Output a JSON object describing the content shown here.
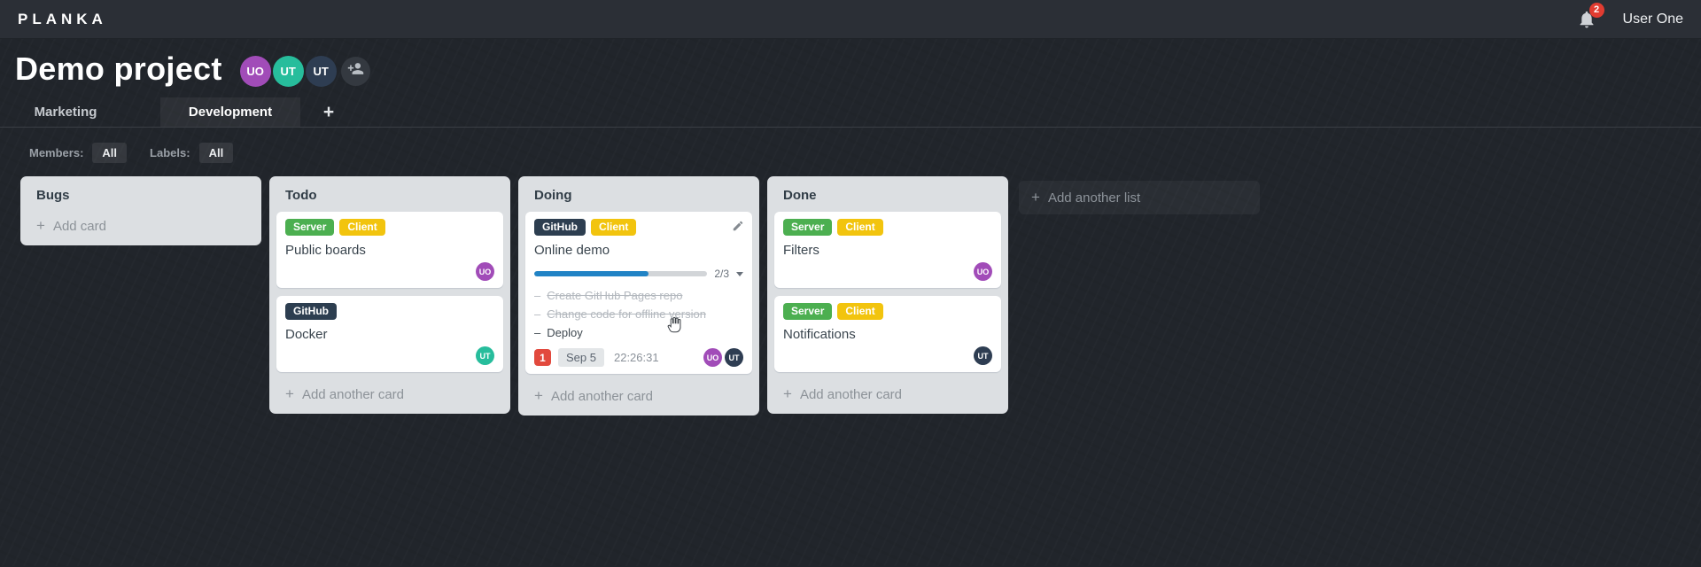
{
  "ui": {
    "plus": "+",
    "task_marker": "–"
  },
  "topbar": {
    "logo": "PLANKA",
    "notifications": {
      "count": "2"
    },
    "user_name": "User One"
  },
  "project": {
    "title": "Demo project",
    "members": [
      {
        "initials": "UO",
        "color": "#a14cb8"
      },
      {
        "initials": "UT",
        "color": "#27bd9c"
      },
      {
        "initials": "UT",
        "color": "#2e3d52"
      }
    ]
  },
  "tabs": {
    "items": [
      {
        "label": "Marketing",
        "active": false
      },
      {
        "label": "Development",
        "active": true
      }
    ]
  },
  "filters": {
    "members_label": "Members:",
    "members_value": "All",
    "labels_label": "Labels:",
    "labels_value": "All"
  },
  "board": {
    "add_list_label": "Add another list",
    "lists": [
      {
        "title": "Bugs",
        "add_card_label": "Add card",
        "cards": []
      },
      {
        "title": "Todo",
        "add_card_label": "Add another card",
        "cards": [
          {
            "title": "Public boards",
            "labels": [
              {
                "text": "Server",
                "color": "#4caf50"
              },
              {
                "text": "Client",
                "color": "#f2c40e"
              }
            ],
            "members": [
              {
                "initials": "UO",
                "color": "#a14cb8"
              }
            ]
          },
          {
            "title": "Docker",
            "labels": [
              {
                "text": "GitHub",
                "color": "#2d3e50"
              }
            ],
            "members": [
              {
                "initials": "UT",
                "color": "#27bd9c"
              }
            ]
          }
        ]
      },
      {
        "title": "Doing",
        "add_card_label": "Add another card",
        "cards": [
          {
            "title": "Online demo",
            "labels": [
              {
                "text": "GitHub",
                "color": "#2d3e50"
              },
              {
                "text": "Client",
                "color": "#f2c40e"
              }
            ],
            "progress": {
              "done": 2,
              "total": 3,
              "label": "2/3",
              "percent": "66%"
            },
            "tasks": [
              {
                "text": "Create GitHub Pages repo",
                "completed": true
              },
              {
                "text": "Change code for offline version",
                "completed": true
              },
              {
                "text": "Deploy",
                "completed": false
              }
            ],
            "notification_count": "1",
            "due_date": "Sep 5",
            "timer": "22:26:31",
            "members": [
              {
                "initials": "UO",
                "color": "#a14cb8"
              },
              {
                "initials": "UT",
                "color": "#2e3d52"
              }
            ]
          }
        ]
      },
      {
        "title": "Done",
        "add_card_label": "Add another card",
        "cards": [
          {
            "title": "Filters",
            "labels": [
              {
                "text": "Server",
                "color": "#4caf50"
              },
              {
                "text": "Client",
                "color": "#f2c40e"
              }
            ],
            "members": [
              {
                "initials": "UO",
                "color": "#a14cb8"
              }
            ]
          },
          {
            "title": "Notifications",
            "labels": [
              {
                "text": "Server",
                "color": "#4caf50"
              },
              {
                "text": "Client",
                "color": "#f2c40e"
              }
            ],
            "members": [
              {
                "initials": "UT",
                "color": "#2e3d52"
              }
            ]
          }
        ]
      }
    ]
  },
  "colors": {
    "topbar_bg": "#2b2f36",
    "board_bg": "#21252b",
    "list_bg": "#dcdfe2",
    "progress_blue": "#2183c5",
    "notification_red": "#e13c31",
    "label_green": "#4caf50",
    "label_yellow": "#f2c40e",
    "label_navy": "#2d3e50",
    "avatar_purple": "#a14cb8",
    "avatar_teal": "#27bd9c",
    "avatar_navy": "#2e3d52"
  }
}
